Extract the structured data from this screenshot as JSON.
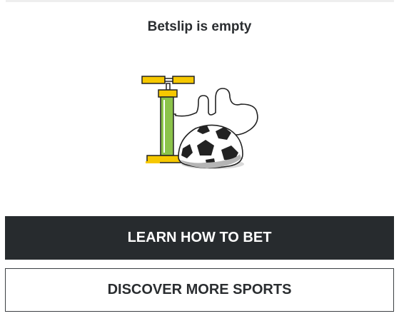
{
  "betslip": {
    "empty_title": "Betslip is empty",
    "illustration_icon": "pump-and-deflated-football-icon"
  },
  "buttons": {
    "learn_label": "LEARN HOW TO BET",
    "discover_label": "DISCOVER MORE SPORTS"
  },
  "colors": {
    "dark_button": "#272b2e",
    "accent_yellow": "#f6c800",
    "accent_green": "#8bc34a"
  }
}
